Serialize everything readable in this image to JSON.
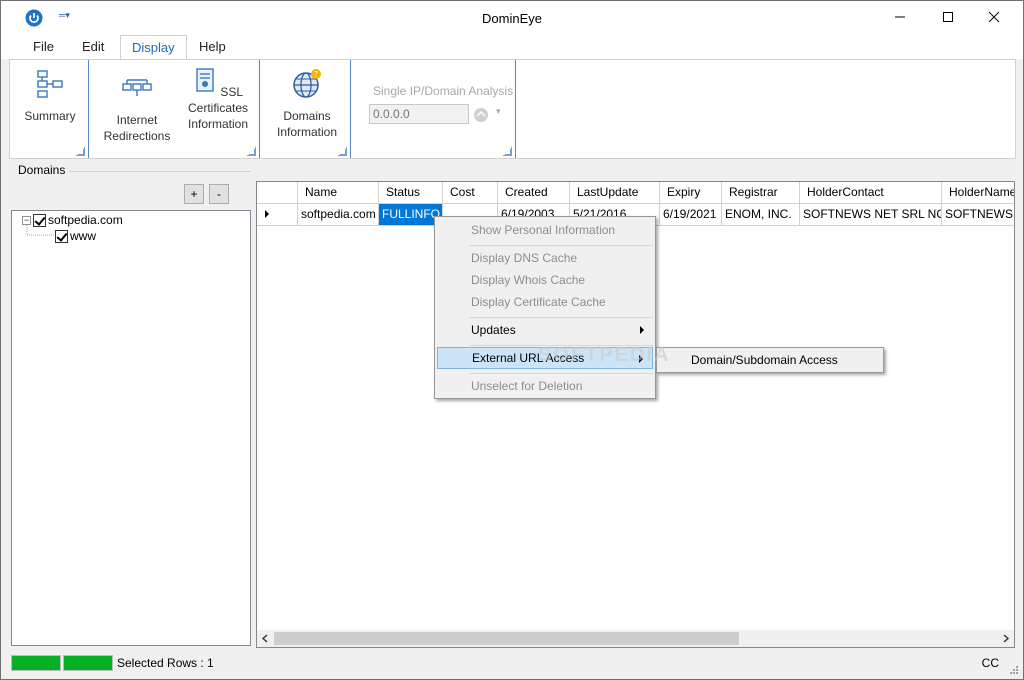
{
  "window": {
    "title": "DominEye"
  },
  "menu": {
    "tabs": [
      "File",
      "Edit",
      "Display",
      "Help"
    ],
    "active": "Display"
  },
  "ribbon": {
    "summary": "Summary",
    "internet_redirections": "Internet Redirections",
    "ssl": "SSL Certificates Information",
    "domains_information": "Domains Information",
    "single_title": "Single IP/Domain Analysis",
    "ip_placeholder": "0.0.0.0"
  },
  "left_panel": {
    "title": "Domains",
    "add": "+",
    "remove": "-",
    "tree": [
      {
        "label": "softpedia.com",
        "checked": true,
        "expanded": true
      },
      {
        "label": "www",
        "checked": true
      }
    ]
  },
  "grid": {
    "columns": [
      "Name",
      "Status",
      "Cost",
      "Created",
      "LastUpdate",
      "Expiry",
      "Registrar",
      "HolderContact",
      "HolderName"
    ],
    "rows": [
      [
        "softpedia.com",
        "FULLINFO",
        "",
        "6/19/2003",
        "5/21/2016",
        "6/19/2021",
        "ENOM, INC.",
        "SOFTNEWS NET SRL NONE",
        "SOFTNEWS N"
      ]
    ]
  },
  "context_menu": {
    "items": [
      {
        "label": "Show Personal Information",
        "disabled": true
      },
      {
        "label": "Display DNS Cache",
        "disabled": true
      },
      {
        "label": "Display Whois Cache",
        "disabled": true
      },
      {
        "label": "Display Certificate Cache",
        "disabled": true
      },
      {
        "label": "Updates",
        "disabled": false
      },
      {
        "label": "External URL Access",
        "disabled": false
      },
      {
        "label": "Unselect for Deletion",
        "disabled": true
      }
    ],
    "submenu": [
      "Domain/Subdomain Access"
    ]
  },
  "watermark": "SOFTPEDIA",
  "status": {
    "selected_rows": "Selected Rows : 1",
    "right": "CC"
  },
  "colors": {
    "accent": "#0078d7",
    "progress": "#06b025",
    "ribbon_separator": "#5b86c9"
  }
}
